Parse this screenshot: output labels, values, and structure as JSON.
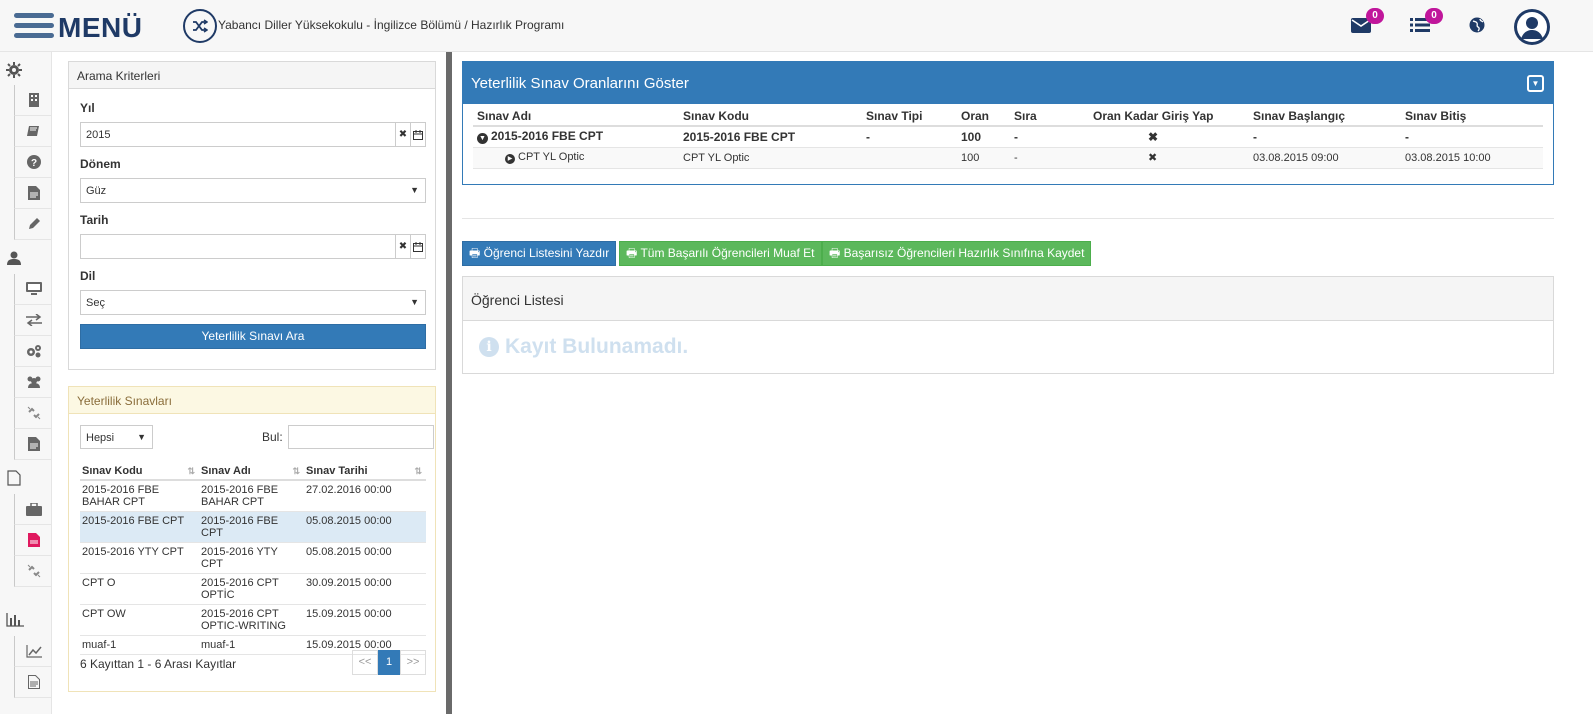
{
  "header": {
    "menu_label": "MENÜ",
    "breadcrumb": "Yabancı Diller Yüksekokulu - İngilizce Bölümü / Hazırlık Programı",
    "mail_badge": "0",
    "list_badge": "0"
  },
  "sidebar_icons": [
    "gear-icon",
    "building-icon",
    "book-icon",
    "question-icon",
    "file-icon",
    "pencil-icon",
    "user-icon",
    "monitor-icon",
    "transfer-icon",
    "gears-icon",
    "users-icon",
    "unlink-icon",
    "file-text-icon",
    "file-outline-icon",
    "briefcase-icon",
    "file-pdf-icon",
    "unlink-icon",
    "bar-chart-icon",
    "line-chart-icon",
    "document-icon"
  ],
  "search": {
    "title": "Arama Kriterleri",
    "year_label": "Yıl",
    "year_value": "2015",
    "term_label": "Dönem",
    "term_value": "Güz",
    "date_label": "Tarih",
    "date_value": "",
    "lang_label": "Dil",
    "lang_value": "Seç",
    "search_button": "Yeterlilik Sınavı Ara"
  },
  "exams": {
    "title": "Yeterlilik Sınavları",
    "filter_value": "Hepsi",
    "find_label": "Bul:",
    "find_value": "",
    "columns": [
      "Sınav Kodu",
      "Sınav Adı",
      "Sınav Tarihi"
    ],
    "rows": [
      {
        "code": "2015-2016 FBE BAHAR CPT",
        "name": "2015-2016 FBE BAHAR CPT",
        "date": "27.02.2016 00:00"
      },
      {
        "code": "2015-2016 FBE CPT",
        "name": "2015-2016 FBE CPT",
        "date": "05.08.2015 00:00"
      },
      {
        "code": "2015-2016 YTY CPT",
        "name": "2015-2016 YTY CPT",
        "date": "05.08.2015 00:00"
      },
      {
        "code": "CPT O",
        "name": "2015-2016 CPT OPTİC",
        "date": "30.09.2015 00:00"
      },
      {
        "code": "CPT OW",
        "name": "2015-2016 CPT OPTIC-WRITING",
        "date": "15.09.2015 00:00"
      },
      {
        "code": "muaf-1",
        "name": "muaf-1",
        "date": "15.09.2015 00:00"
      }
    ],
    "summary": "6 Kayıttan 1 - 6 Arası Kayıtlar",
    "pager": {
      "prev": "<<",
      "current": "1",
      "next": ">>"
    }
  },
  "rates": {
    "title": "Yeterlilik Sınav Oranlarını Göster",
    "columns": [
      "Sınav Adı",
      "Sınav Kodu",
      "Sınav Tipi",
      "Oran",
      "Sıra",
      "Oran Kadar Giriş Yap",
      "Sınav Başlangıç",
      "Sınav Bitiş"
    ],
    "parent": {
      "name": "2015-2016 FBE CPT",
      "code": "2015-2016 FBE CPT",
      "type": "-",
      "rate": "100",
      "order": "-",
      "entry": "✖",
      "start": "-",
      "end": "-"
    },
    "child": {
      "name": "CPT YL Optic",
      "code": "CPT YL Optic",
      "type": "",
      "rate": "100",
      "order": "-",
      "entry": "✖",
      "start": "03.08.2015 09:00",
      "end": "03.08.2015 10:00"
    }
  },
  "actions": {
    "print_list": "Öğrenci Listesini Yazdır",
    "exempt_all": "Tüm Başarılı Öğrencileri Muaf Et",
    "enroll_failed": "Başarısız Öğrencileri Hazırlık Sınıfına Kaydet"
  },
  "students": {
    "title": "Öğrenci Listesi",
    "empty_message": "Kayıt Bulunamadı."
  },
  "colors": {
    "primary": "#337ab7",
    "success": "#5cb85c",
    "badge": "#c0169b",
    "brand": "#1f3a66"
  }
}
